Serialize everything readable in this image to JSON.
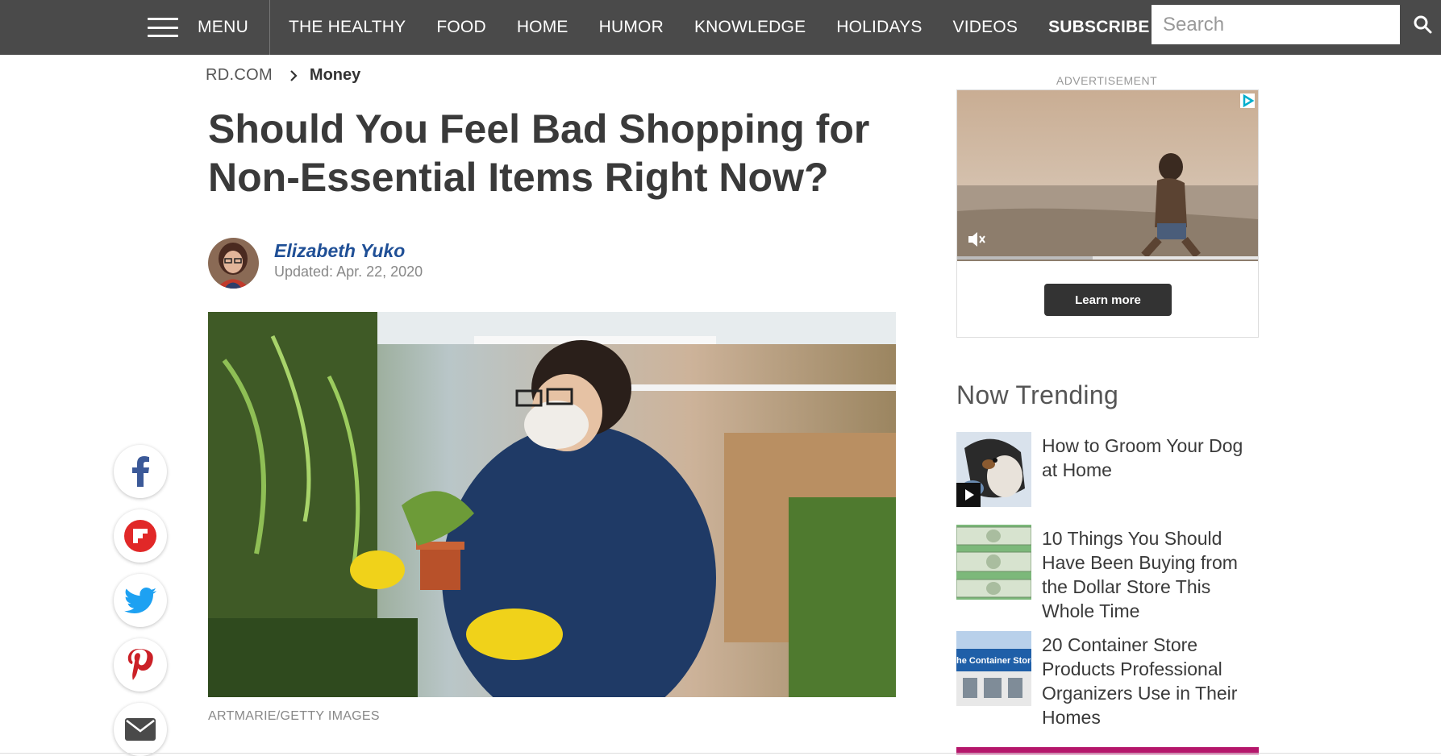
{
  "nav": {
    "menu_label": "MENU",
    "items": [
      {
        "label": "THE HEALTHY"
      },
      {
        "label": "FOOD"
      },
      {
        "label": "HOME"
      },
      {
        "label": "HUMOR"
      },
      {
        "label": "KNOWLEDGE"
      },
      {
        "label": "HOLIDAYS"
      },
      {
        "label": "VIDEOS"
      },
      {
        "label": "SUBSCRIBE"
      }
    ],
    "search_placeholder": "Search",
    "search_icon": "search-icon"
  },
  "breadcrumb": {
    "home": "RD.COM",
    "current": "Money",
    "separator_icon": "chevron-right-icon"
  },
  "article": {
    "title": "Should You Feel Bad Shopping for Non-Essential Items Right Now?",
    "author": "Elizabeth Yuko",
    "updated": "Updated: Apr. 22, 2020",
    "image_credit": "ARTMARIE/GETTY IMAGES"
  },
  "share": [
    {
      "icon": "facebook-icon"
    },
    {
      "icon": "flipboard-icon"
    },
    {
      "icon": "twitter-icon"
    },
    {
      "icon": "pinterest-icon"
    },
    {
      "icon": "email-icon"
    }
  ],
  "ad": {
    "label": "ADVERTISEMENT",
    "cta": "Learn more",
    "progress": 0.45,
    "icons": [
      "adchoices-icon",
      "mute-icon"
    ]
  },
  "trending": {
    "title": "Now Trending",
    "items": [
      {
        "title": "How to Groom Your Dog at Home",
        "thumb_icon": "play-icon"
      },
      {
        "title": "10 Things You Should Have Been Buying from the Dollar Store This Whole Time"
      },
      {
        "title": "20 Container Store Products Professional Organizers Use in Their Homes",
        "thumb_text": "he Container Store"
      }
    ]
  },
  "colors": {
    "nav_bg": "#4a4a4a",
    "author_link": "#1f4f96",
    "accent_bar": "#b5166b"
  }
}
